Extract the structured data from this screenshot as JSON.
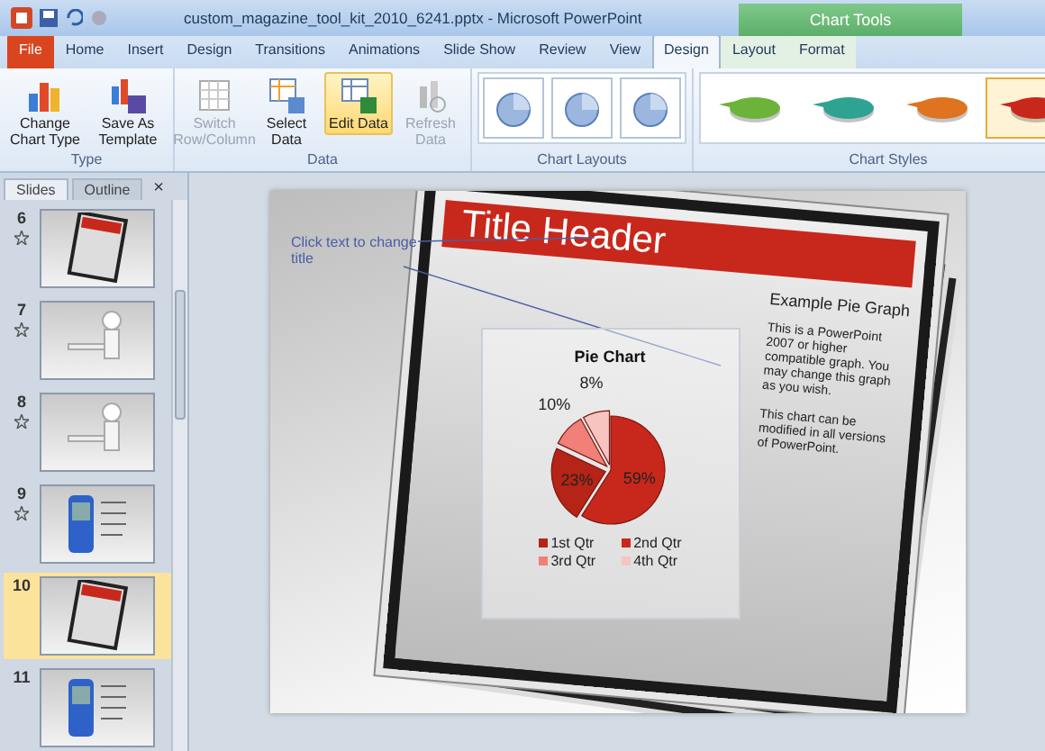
{
  "window": {
    "title": "custom_magazine_tool_kit_2010_6241.pptx  -  Microsoft PowerPoint"
  },
  "contextual_group": {
    "label": "Chart Tools"
  },
  "tabs": [
    {
      "label": "File",
      "kind": "file",
      "selected": false
    },
    {
      "label": "Home",
      "kind": "normal",
      "selected": false
    },
    {
      "label": "Insert",
      "kind": "normal",
      "selected": false
    },
    {
      "label": "Design",
      "kind": "normal",
      "selected": false
    },
    {
      "label": "Transitions",
      "kind": "normal",
      "selected": false
    },
    {
      "label": "Animations",
      "kind": "normal",
      "selected": false
    },
    {
      "label": "Slide Show",
      "kind": "normal",
      "selected": false
    },
    {
      "label": "Review",
      "kind": "normal",
      "selected": false
    },
    {
      "label": "View",
      "kind": "normal",
      "selected": false
    },
    {
      "label": "Design",
      "kind": "contextual",
      "selected": true
    },
    {
      "label": "Layout",
      "kind": "contextual",
      "selected": false
    },
    {
      "label": "Format",
      "kind": "contextual",
      "selected": false
    }
  ],
  "ribbon_groups": [
    {
      "label": "Type",
      "kind": "buttons",
      "buttons": [
        {
          "label": "Change Chart Type",
          "disabled": false,
          "hovered": false
        },
        {
          "label": "Save As Template",
          "disabled": false,
          "hovered": false
        }
      ]
    },
    {
      "label": "Data",
      "kind": "buttons",
      "buttons": [
        {
          "label": "Switch Row/Column",
          "disabled": true,
          "hovered": false
        },
        {
          "label": "Select Data",
          "disabled": false,
          "hovered": false
        },
        {
          "label": "Edit Data",
          "disabled": false,
          "hovered": true
        },
        {
          "label": "Refresh Data",
          "disabled": true,
          "hovered": false
        }
      ]
    },
    {
      "label": "Chart Layouts",
      "kind": "layouts",
      "layouts": [
        {
          "selected": false
        },
        {
          "selected": false
        },
        {
          "selected": false
        }
      ]
    },
    {
      "label": "Chart Styles",
      "kind": "styles",
      "styles": [
        {
          "color": "#6cb33a",
          "selected": false
        },
        {
          "color": "#2fa392",
          "selected": false
        },
        {
          "color": "#e0731f",
          "selected": false
        },
        {
          "color": "#c8281c",
          "selected": true
        }
      ]
    }
  ],
  "pane": {
    "tabs": [
      {
        "label": "Slides",
        "selected": true
      },
      {
        "label": "Outline",
        "selected": false
      }
    ],
    "close": "×"
  },
  "slides": [
    {
      "number": "6",
      "animated": true,
      "selected": false,
      "kind": "magazine"
    },
    {
      "number": "7",
      "animated": true,
      "selected": false,
      "kind": "figure"
    },
    {
      "number": "8",
      "animated": true,
      "selected": false,
      "kind": "figure"
    },
    {
      "number": "9",
      "animated": true,
      "selected": false,
      "kind": "device"
    },
    {
      "number": "10",
      "animated": false,
      "selected": true,
      "kind": "magazine"
    },
    {
      "number": "11",
      "animated": false,
      "selected": false,
      "kind": "device"
    }
  ],
  "slide": {
    "caption": "Click text to change title",
    "header": "Title Header",
    "subtitle": "Example Pie Graph",
    "paragraphs": [
      "This is a PowerPoint 2007 or higher compatible graph. You may change this graph as you wish.",
      "This chart can be modified in all versions of PowerPoint."
    ],
    "chart": {
      "chart_data": {
        "type": "pie",
        "title": "Pie Chart",
        "categories": [
          "1st Qtr",
          "2nd Qtr",
          "3rd Qtr",
          "4th Qtr"
        ],
        "values": [
          23,
          59,
          10,
          8
        ],
        "value_labels": [
          "23%",
          "59%",
          "10%",
          "8%"
        ]
      }
    }
  }
}
